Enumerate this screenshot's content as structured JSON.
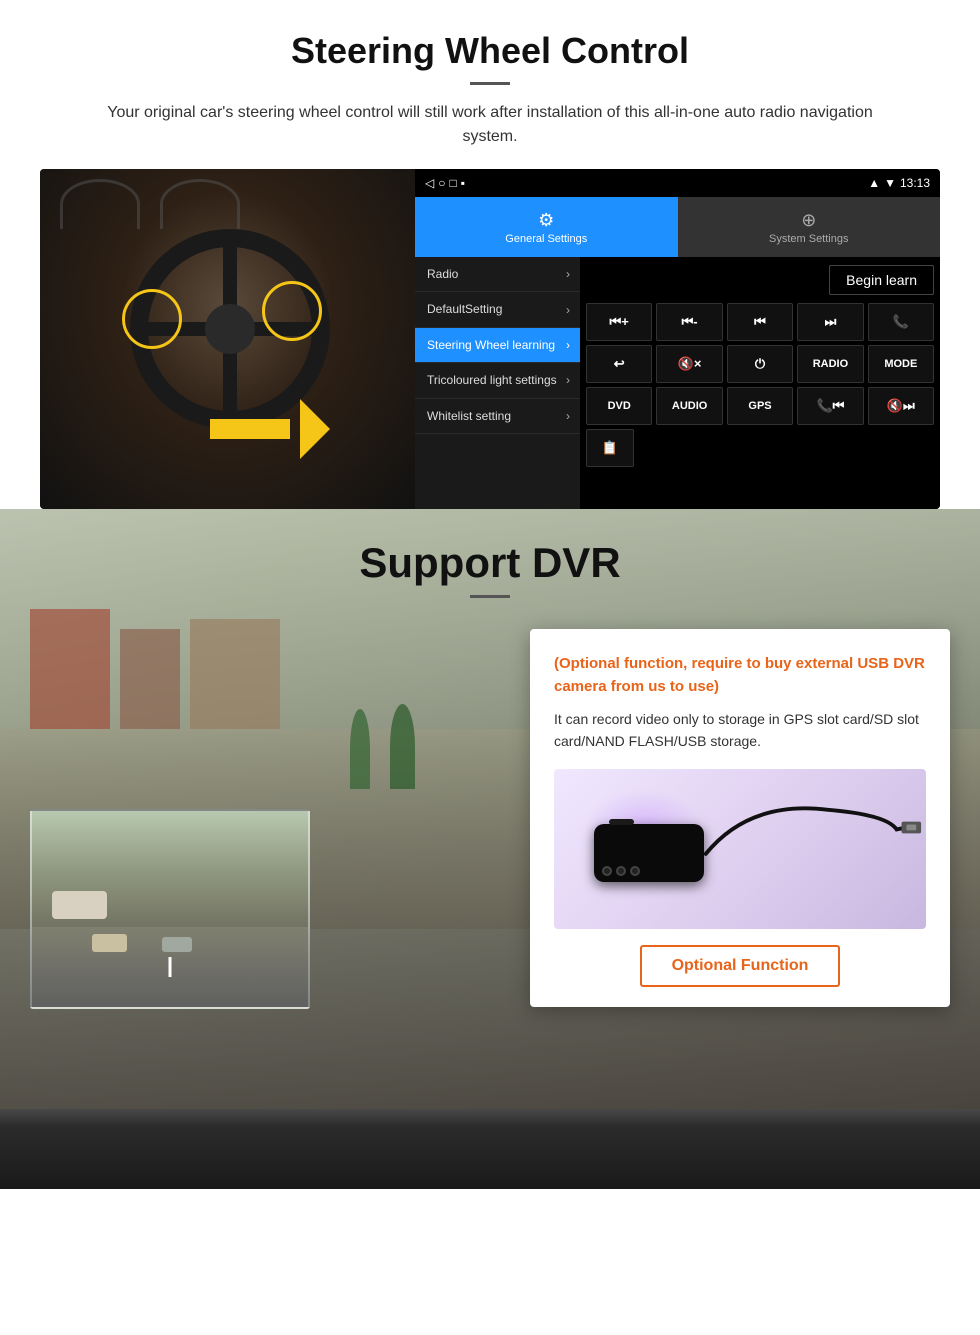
{
  "page": {
    "section1": {
      "title": "Steering Wheel Control",
      "subtitle": "Your original car's steering wheel control will still work after installation of this all-in-one auto radio navigation system.",
      "divider": "—"
    },
    "android_ui": {
      "status_bar": {
        "time": "13:13",
        "signal_icon": "▼",
        "wifi_icon": "▲"
      },
      "nav_bar": {
        "back": "◁",
        "home": "○",
        "recent": "□",
        "menu": "▪"
      },
      "tabs": {
        "general": {
          "label": "General Settings",
          "icon": "⚙"
        },
        "system": {
          "label": "System Settings",
          "icon": "🌐"
        }
      },
      "menu_items": [
        {
          "label": "Radio",
          "active": false
        },
        {
          "label": "DefaultSetting",
          "active": false
        },
        {
          "label": "Steering Wheel learning",
          "active": true
        },
        {
          "label": "Tricoloured light settings",
          "active": false
        },
        {
          "label": "Whitelist setting",
          "active": false
        }
      ],
      "begin_learn_label": "Begin learn",
      "control_buttons": [
        [
          "⏮+",
          "⏮-",
          "⏮",
          "⏭",
          "📞"
        ],
        [
          "↩",
          "🔇×",
          "⏻",
          "RADIO",
          "MODE"
        ],
        [
          "DVD",
          "AUDIO",
          "GPS",
          "📞⏮",
          "🔇⏭"
        ],
        [
          "📋"
        ]
      ]
    },
    "section2": {
      "title": "Support DVR",
      "divider": "—",
      "card": {
        "optional_text": "(Optional function, require to buy external USB DVR camera from us to use)",
        "desc_text": "It can record video only to storage in GPS slot card/SD slot card/NAND FLASH/USB storage.",
        "optional_function_btn": "Optional Function"
      }
    }
  }
}
